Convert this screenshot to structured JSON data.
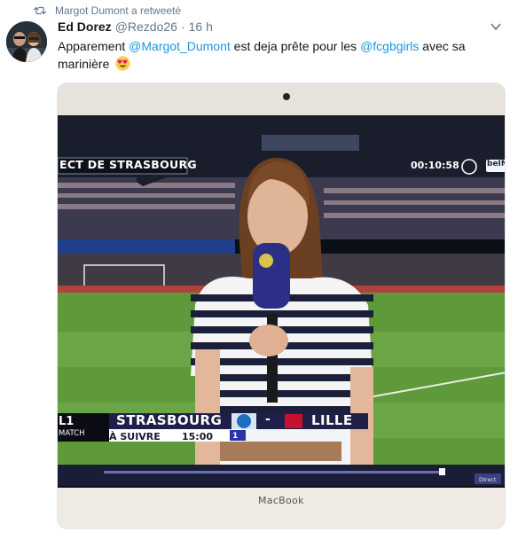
{
  "retweet": {
    "text": "Margot Dumont a retweeté",
    "icon": "retweet-icon"
  },
  "tweet": {
    "display_name": "Ed Dorez",
    "handle": "@Rezdo26",
    "separator": "·",
    "time": "16 h",
    "text_parts": {
      "t1": "Apparement ",
      "m1": "@Margot_Dumont",
      "t2": " est deja prête pour les ",
      "m2": "@fcgbgirls",
      "t3": " avec sa marinière"
    },
    "emoji": "heart-eyes-emoji",
    "menu_icon": "chevron-down-icon"
  },
  "media": {
    "broadcast_label": "ECT DE STRASBOURG",
    "clock": "00:10:58",
    "channel_logo": "beIN",
    "competition": "L1",
    "competition_sub": "MATCH",
    "home_team": "STRASBOURG",
    "score_separator": "-",
    "away_team": "LILLE",
    "next_label": "À SUIVRE",
    "next_time": "15:00",
    "channel_number": "1",
    "player_button": "Direct",
    "laptop_brand": "MacBook"
  },
  "colors": {
    "link": "#1b95e0",
    "secondary": "#657786",
    "text": "#14171a"
  }
}
